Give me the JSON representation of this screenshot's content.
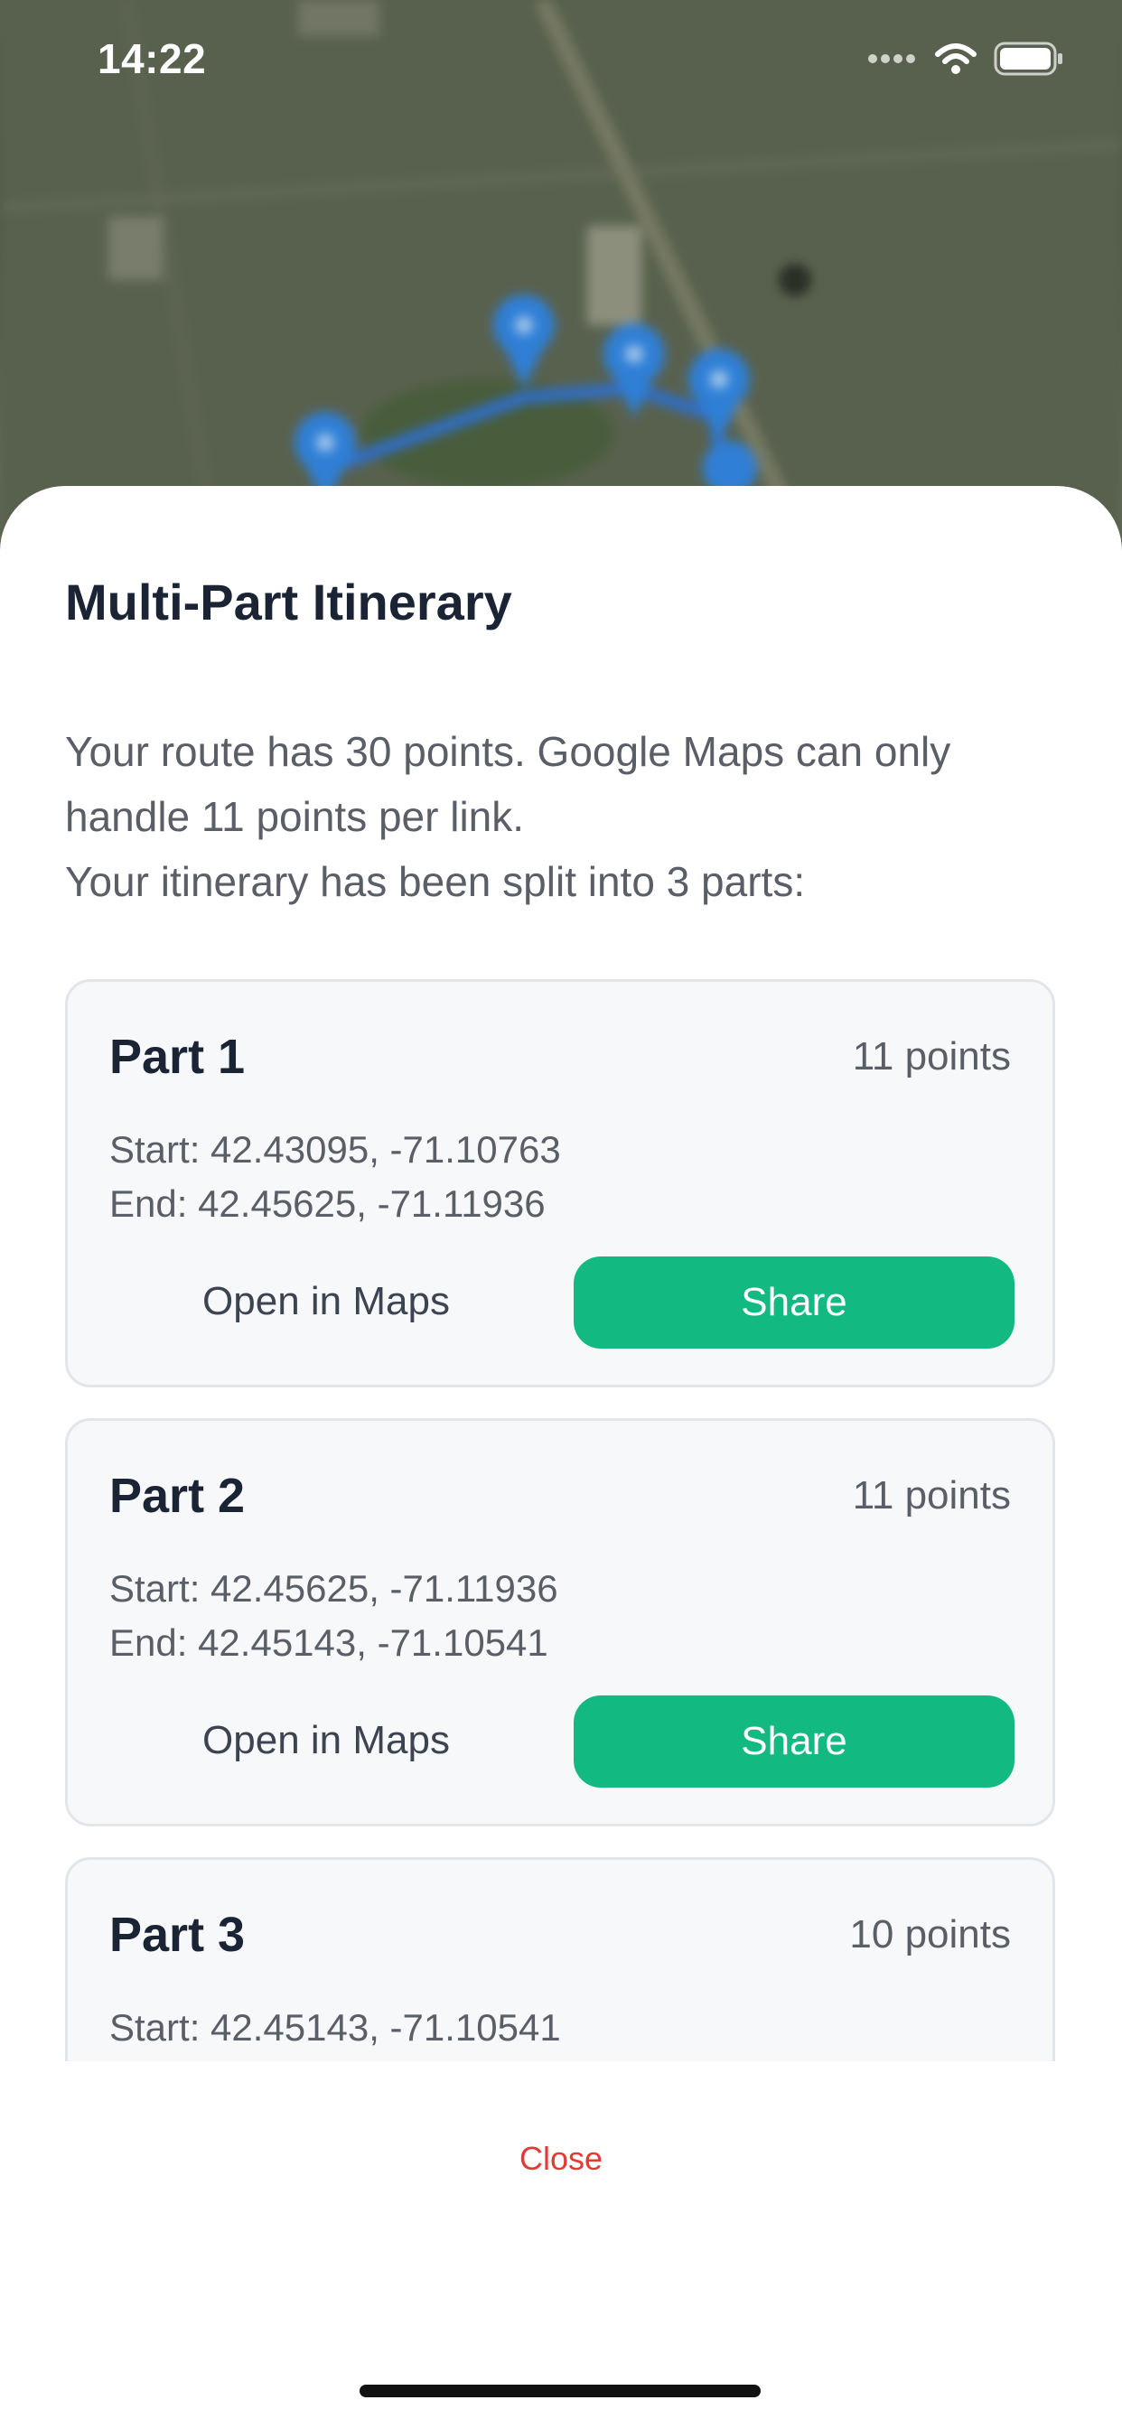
{
  "status_bar": {
    "time": "14:22",
    "icons": [
      "signal-icon",
      "wifi-icon",
      "battery-icon"
    ]
  },
  "map": {
    "pin_color": "#2f7fd6",
    "route_color": "#2f6fc9"
  },
  "sheet": {
    "title": "Multi-Part Itinerary",
    "description": [
      "Your route has 30 points. Google Maps can only",
      "handle 11 points per link.",
      "Your itinerary has been split into 3 parts:"
    ],
    "open_label": "Open in Maps",
    "share_label": "Share",
    "parts": [
      {
        "name": "Part 1",
        "points": "11 points",
        "start": "Start: 42.43095, -71.10763",
        "end": "End: 42.45625, -71.11936"
      },
      {
        "name": "Part 2",
        "points": "11 points",
        "start": "Start: 42.45625, -71.11936",
        "end": "End: 42.45143, -71.10541"
      },
      {
        "name": "Part 3",
        "points": "10 points",
        "start": "Start: 42.45143, -71.10541"
      }
    ],
    "close_label": "Close"
  },
  "colors": {
    "accent": "#12b981",
    "close": "#e53935",
    "title": "#1b2434",
    "muted": "#5a5f67"
  }
}
